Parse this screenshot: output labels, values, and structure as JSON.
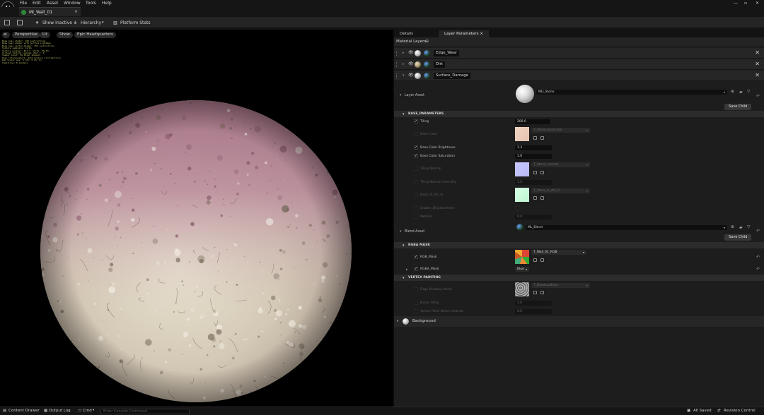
{
  "menu": {
    "file": "File",
    "edit": "Edit",
    "asset": "Asset",
    "window": "Window",
    "tools": "Tools",
    "help": "Help"
  },
  "logo_text": "U",
  "document_tab": {
    "label": "MI_Wall_01",
    "close": "×"
  },
  "toolbar": {
    "show_inactive": "Show Inactive",
    "hierarchy": "Hierarchy",
    "platform_stats": "Platform Stats"
  },
  "viewport": {
    "perspective": "Perspective",
    "lit": "Lit",
    "show": "Show",
    "preview_scene": "Epic Headquarters",
    "stats_text": "Base pass shader: 184 instructions\nBase pass shader with Surface Lightmap\nBase pass vertex shader: 150 instructions\nTexture samplers: 11/16\nTexture Lookups (Est.): VS(0), PS(31)\nVirtual Texture Lookups (Est.): 0\nShader Count: 36 Pixel shaders\nUser interpolators: 4/16 Scalars (1/4 Vectors)\nLWC Scalar ops: 0 (PS: 0 VS: 0)\nCompiling: 0 shaders"
  },
  "panel": {
    "tabs": {
      "details": "Details",
      "layer_parameters": "Layer Parameters",
      "close": "×"
    },
    "material_layers": "Material Layers",
    "layers": [
      {
        "name": "Edge_Wear"
      },
      {
        "name": "Dirt"
      },
      {
        "name": "Surface_Damage"
      }
    ],
    "layer_asset": {
      "label": "Layer Asset",
      "value": "MLI_Stone",
      "save_child": "Save Child"
    },
    "base_parameters": {
      "header": "BASE_PARAMETERS",
      "tiling": {
        "label": "Tiling",
        "value": "200.0"
      },
      "base_color": {
        "label": "Base Color",
        "texture": "T_Stone_basecolor"
      },
      "brightness": {
        "label": "Base Color Brightness",
        "value": "1.3"
      },
      "saturation": {
        "label": "Base Color Saturation",
        "value": "1.0"
      },
      "tiling_normal": {
        "label": "Tiling Normal",
        "texture": "T_Stone_normal"
      },
      "tiling_normal_intensity": {
        "label": "Tiling Normal Intensity",
        "value": "1.0"
      },
      "basic_r_ao_h": {
        "label": "Basic_R_AO_H",
        "texture": "T_Stone_R_AO_H"
      },
      "enable_displacement": {
        "label": "Enable_Displacement"
      },
      "metallic": {
        "label": "Metallic",
        "value": "0.0"
      }
    },
    "blend_asset": {
      "label": "Blend Asset",
      "value": "ML_Blend",
      "save_child": "Save Child"
    },
    "rgba_mask": {
      "header": "RGBA MASK",
      "rgb_mask": {
        "label": "RGB_Mask",
        "texture": "T_Wall_01_RGB"
      },
      "rgba_mask": {
        "label": "RGBA_Mask",
        "channel": "Blue"
      }
    },
    "vertex_painting": {
      "header": "VERTEX PAINTING",
      "edge_breakup": {
        "label": "Edge Breakup Noise",
        "texture": "T_BreakupNoise"
      },
      "noise_tiling": {
        "label": "Noise Tiling",
        "value": "1.0"
      },
      "vertex_paint_contrast": {
        "label": "Vertex Paint Noise contrast",
        "value": "0.0"
      }
    },
    "background": {
      "label": "Background"
    }
  },
  "status": {
    "content_drawer": "Content Drawer",
    "output_log": "Output Log",
    "cmd": "Cmd",
    "console_placeholder": "Enter Console Command",
    "all_saved": "All Saved",
    "revision_control": "Revision Control"
  },
  "colors": {
    "accent": "#2c8a3a",
    "viewport_bg": "#000000",
    "panel_bg": "#1d1d1d",
    "planet_pink": "#b98a9a",
    "planet_cream": "#dcd6c4"
  }
}
